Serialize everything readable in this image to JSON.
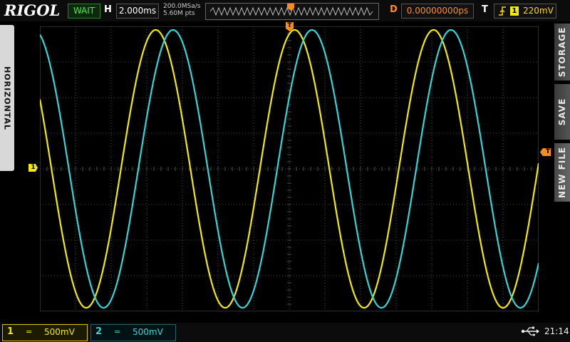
{
  "header": {
    "logo": "RIGOL",
    "run_status": "WAIT",
    "horizontal_label": "H",
    "timebase": "2.000ms",
    "sample_rate": "200.0MSa/s",
    "memory_depth": "5.60M pts",
    "delay_label": "D",
    "delay_value": "0.00000000ps",
    "trigger_label": "T",
    "trigger_slope_icon": "rising-edge-icon",
    "trigger_source": "1",
    "trigger_level": "220mV"
  },
  "side_tabs": {
    "left": "HORIZONTAL",
    "right": [
      "STORAGE",
      "SAVE",
      "NEW FILE"
    ]
  },
  "markers": {
    "ch1_ground": "1",
    "trigger_position": "T",
    "trigger_level_marker": "T"
  },
  "channels": [
    {
      "number": "1",
      "coupling": "=",
      "scale": "500mV",
      "color": "#f2ea00"
    },
    {
      "number": "2",
      "coupling": "=",
      "scale": "500mV",
      "color": "#33d6d6"
    }
  ],
  "status": {
    "usb_icon": "usb-icon",
    "time": "21:14"
  },
  "chart_data": {
    "type": "line",
    "grid_divisions": {
      "x": 14,
      "y": 8
    },
    "x_unit": "ms",
    "x_per_division": 2.0,
    "y_per_division_mV": 500,
    "series": [
      {
        "name": "1",
        "color": "#f2ea00",
        "amplitude_mV": 1950,
        "period_ms": 7.8,
        "phase_deg": 150
      },
      {
        "name": "2",
        "color": "#33d6d6",
        "amplitude_mV": 1950,
        "period_ms": 7.8,
        "phase_deg": 105
      }
    ]
  }
}
